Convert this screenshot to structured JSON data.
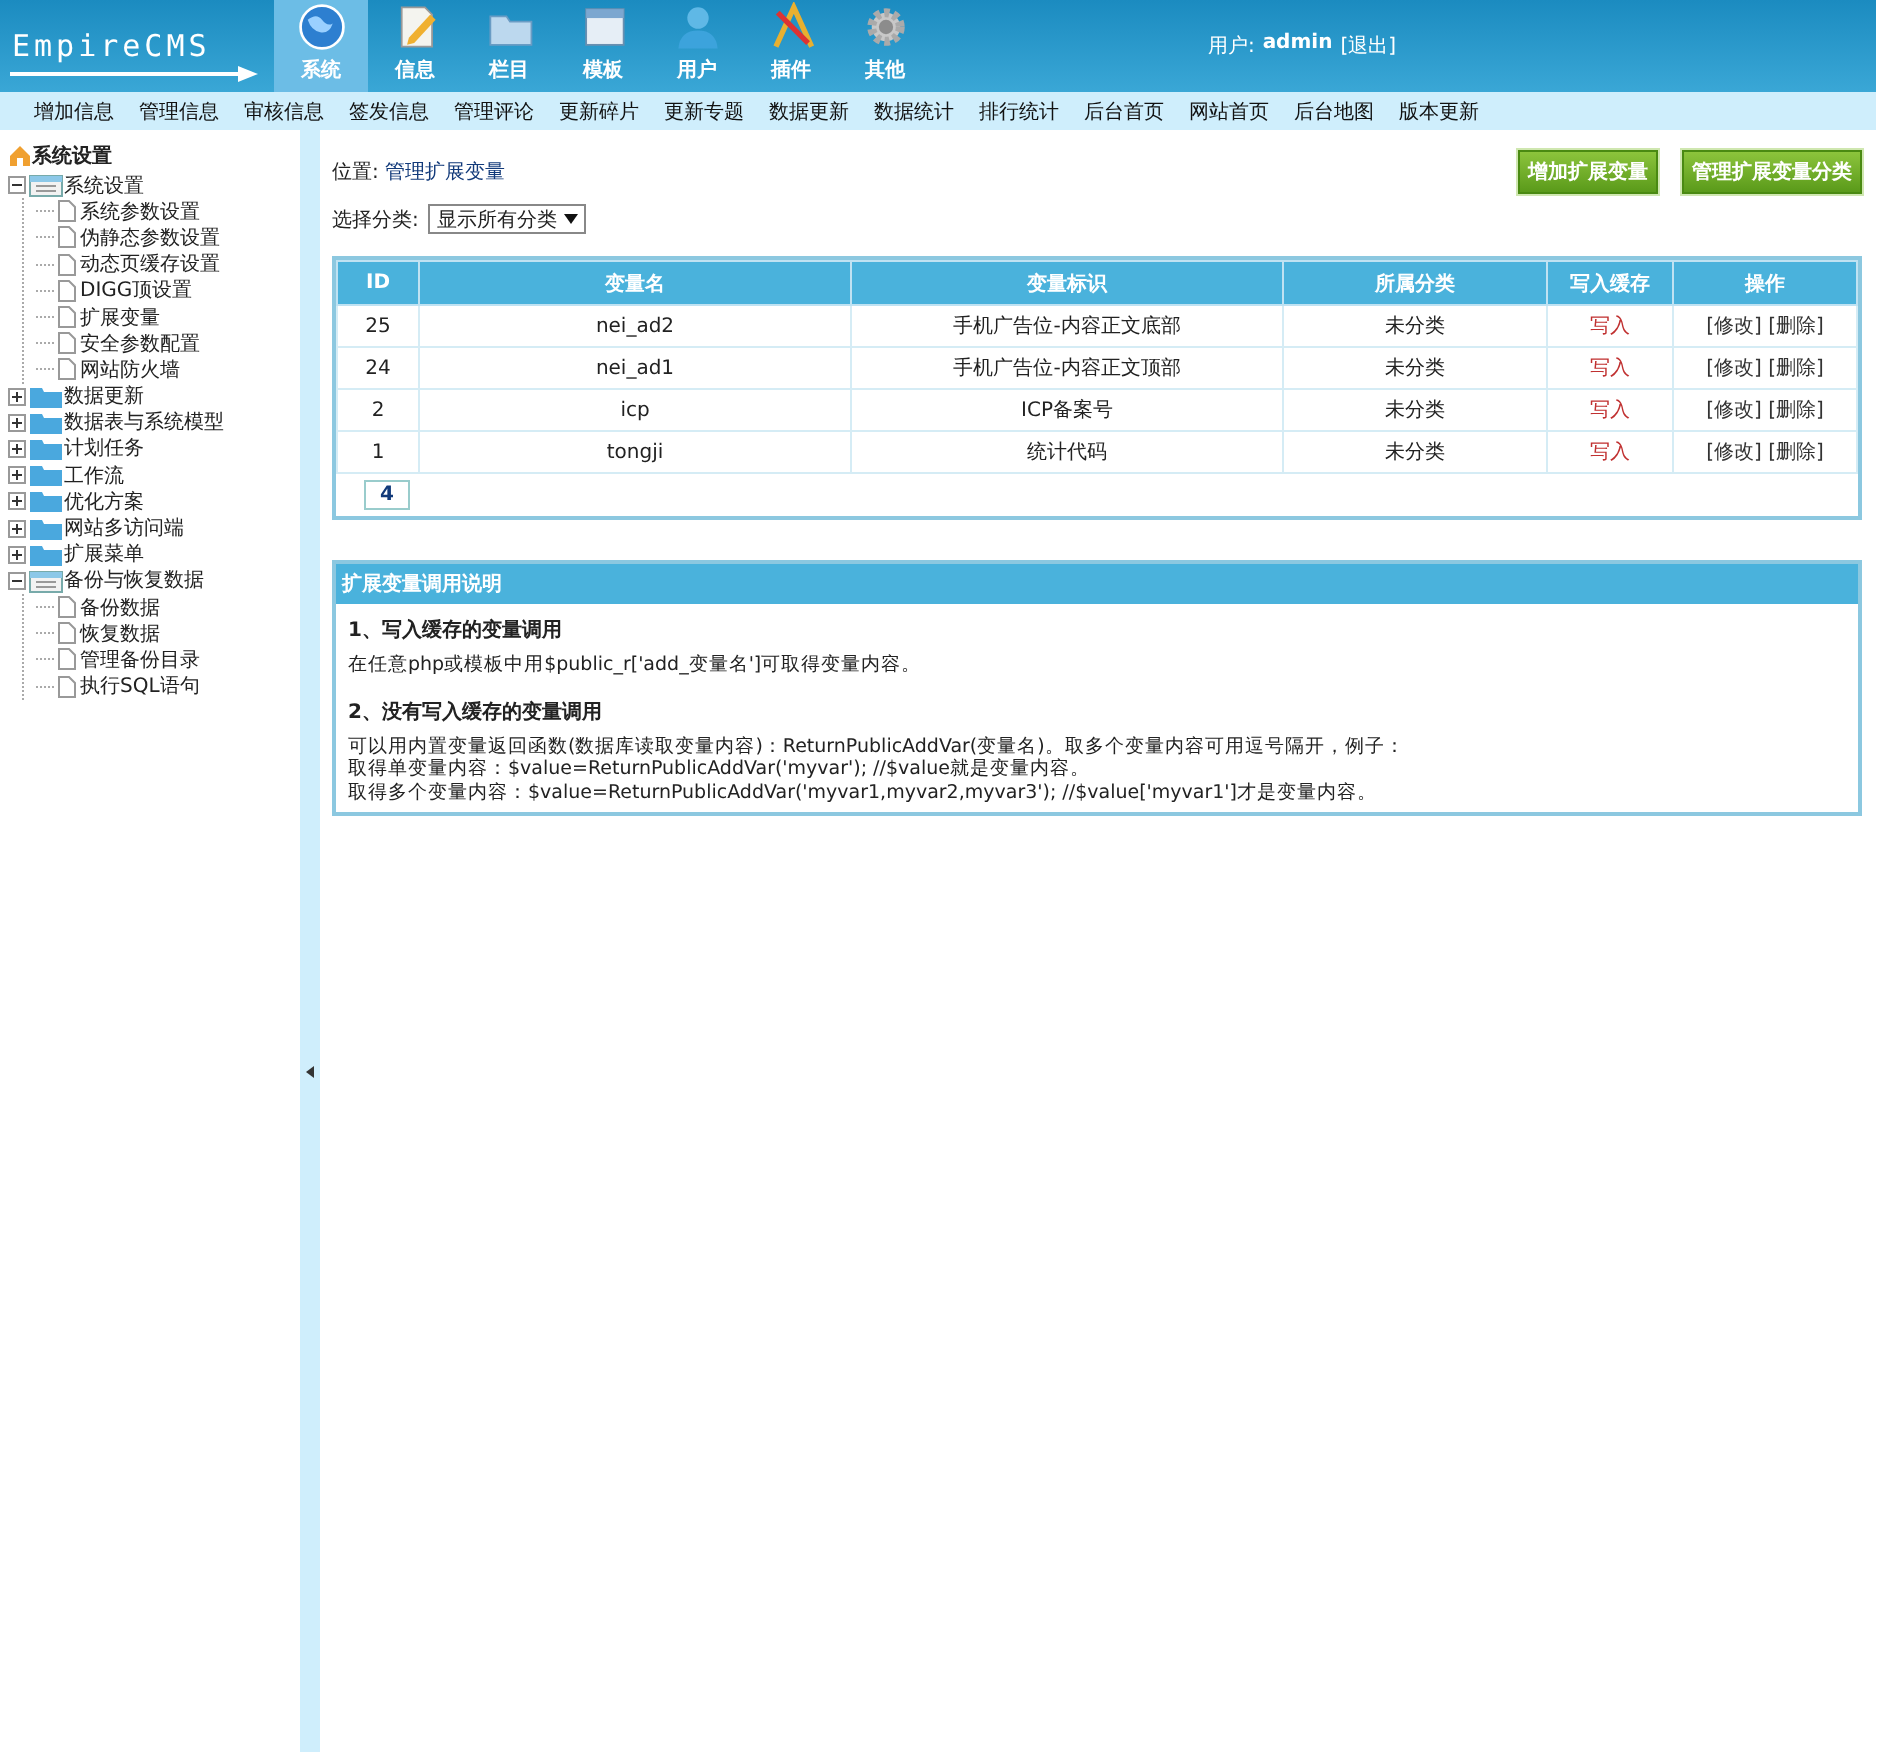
{
  "header": {
    "logo": "EmpireCMS",
    "user_label": "用户:",
    "user": "admin",
    "logout": "[退出]",
    "nav": [
      {
        "label": "系统",
        "selected": true
      },
      {
        "label": "信息",
        "selected": false
      },
      {
        "label": "栏目",
        "selected": false
      },
      {
        "label": "模板",
        "selected": false
      },
      {
        "label": "用户",
        "selected": false
      },
      {
        "label": "插件",
        "selected": false
      },
      {
        "label": "其他",
        "selected": false
      }
    ]
  },
  "menu": [
    "增加信息",
    "管理信息",
    "审核信息",
    "签发信息",
    "管理评论",
    "更新碎片",
    "更新专题",
    "数据更新",
    "数据统计",
    "排行统计",
    "后台首页",
    "网站首页",
    "后台地图",
    "版本更新"
  ],
  "sidebar": {
    "title": "系统设置",
    "items": [
      {
        "label": "系统设置",
        "expanded": true,
        "children": [
          {
            "label": "系统参数设置"
          },
          {
            "label": "伪静态参数设置"
          },
          {
            "label": "动态页缓存设置"
          },
          {
            "label": "DIGG顶设置"
          },
          {
            "label": "扩展变量"
          },
          {
            "label": "安全参数配置"
          },
          {
            "label": "网站防火墙"
          }
        ]
      },
      {
        "label": "数据更新",
        "expanded": false
      },
      {
        "label": "数据表与系统模型",
        "expanded": false
      },
      {
        "label": "计划任务",
        "expanded": false
      },
      {
        "label": "工作流",
        "expanded": false
      },
      {
        "label": "优化方案",
        "expanded": false
      },
      {
        "label": "网站多访问端",
        "expanded": false
      },
      {
        "label": "扩展菜单",
        "expanded": false
      },
      {
        "label": "备份与恢复数据",
        "expanded": true,
        "children": [
          {
            "label": "备份数据"
          },
          {
            "label": "恢复数据"
          },
          {
            "label": "管理备份目录"
          },
          {
            "label": "执行SQL语句"
          }
        ]
      }
    ]
  },
  "location": {
    "label": "位置:",
    "link": "管理扩展变量"
  },
  "buttons": [
    "增加扩展变量",
    "管理扩展变量分类"
  ],
  "filter": {
    "label": "选择分类:",
    "value": "显示所有分类"
  },
  "table": {
    "columns": [
      "ID",
      "变量名",
      "变量标识",
      "所属分类",
      "写入缓存",
      "操作"
    ],
    "rows": [
      {
        "id": "25",
        "name": "nei_ad2",
        "tag": "手机广告位-内容正文底部",
        "category": "未分类",
        "cache": "写入",
        "edit": "[修改]",
        "delete": "[删除]"
      },
      {
        "id": "24",
        "name": "nei_ad1",
        "tag": "手机广告位-内容正文顶部",
        "category": "未分类",
        "cache": "写入",
        "edit": "[修改]",
        "delete": "[删除]"
      },
      {
        "id": "2",
        "name": "icp",
        "tag": "ICP备案号",
        "category": "未分类",
        "cache": "写入",
        "edit": "[修改]",
        "delete": "[删除]"
      },
      {
        "id": "1",
        "name": "tongji",
        "tag": "统计代码",
        "category": "未分类",
        "cache": "写入",
        "edit": "[修改]",
        "delete": "[删除]"
      }
    ],
    "pagination": "4"
  },
  "notes": {
    "title": "扩展变量调用说明",
    "sections": [
      {
        "heading": "1、写入缓存的变量调用",
        "lines": [
          "在任意php或模板中用$public_r['add_变量名']可取得变量内容。"
        ]
      },
      {
        "heading": "2、没有写入缓存的变量调用",
        "lines": [
          "可以用内置变量返回函数(数据库读取变量内容)：ReturnPublicAddVar(变量名)。取多个变量内容可用逗号隔开，例子：",
          "取得单变量内容：$value=ReturnPublicAddVar('myvar'); //$value就是变量内容。",
          "取得多个变量内容：$value=ReturnPublicAddVar('myvar1,myvar2,myvar3'); //$value['myvar1']才是变量内容。"
        ]
      }
    ]
  }
}
